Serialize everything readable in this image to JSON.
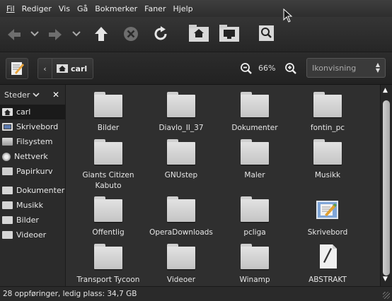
{
  "menubar": {
    "items": [
      {
        "label": "Fil"
      },
      {
        "label": "Rediger"
      },
      {
        "label": "Vis"
      },
      {
        "label": "Gå"
      },
      {
        "label": "Bokmerker"
      },
      {
        "label": "Faner"
      },
      {
        "label": "Hjelp"
      }
    ]
  },
  "toolbar": {
    "buttons": [
      "back-icon",
      "back-history-chevron-icon",
      "forward-icon",
      "forward-history-chevron-icon",
      "up-icon",
      "stop-icon",
      "reload-icon",
      "home-folder-icon",
      "computer-icon",
      "search-icon"
    ]
  },
  "location": {
    "crumb": "carl",
    "zoom": "66%",
    "view_mode": "Ikonvisning"
  },
  "sidebar": {
    "header": "Steder",
    "places": [
      {
        "label": "carl",
        "icon": "home-icon",
        "active": true
      },
      {
        "label": "Skrivebord",
        "icon": "desktop-icon"
      },
      {
        "label": "Filsystem",
        "icon": "drive-icon"
      },
      {
        "label": "Nettverk",
        "icon": "network-icon"
      },
      {
        "label": "Papirkurv",
        "icon": "trash-icon"
      }
    ],
    "bookmarks": [
      {
        "label": "Dokumenter",
        "icon": "folder-icon"
      },
      {
        "label": "Musikk",
        "icon": "folder-icon"
      },
      {
        "label": "Bilder",
        "icon": "folder-icon"
      },
      {
        "label": "Videoer",
        "icon": "folder-icon"
      }
    ]
  },
  "files": [
    {
      "name": "Bilder",
      "icon": "folder-icon"
    },
    {
      "name": "Diavlo_II_37",
      "icon": "folder-icon"
    },
    {
      "name": "Dokumenter",
      "icon": "folder-icon"
    },
    {
      "name": "fontin_pc",
      "icon": "folder-icon"
    },
    {
      "name": "Giants Citizen Kabuto",
      "icon": "folder-icon"
    },
    {
      "name": "GNUstep",
      "icon": "folder-icon"
    },
    {
      "name": "Maler",
      "icon": "folder-icon"
    },
    {
      "name": "Musikk",
      "icon": "folder-icon"
    },
    {
      "name": "Offentlig",
      "icon": "folder-icon"
    },
    {
      "name": "OperaDownloads",
      "icon": "folder-icon"
    },
    {
      "name": "pcliga",
      "icon": "folder-icon"
    },
    {
      "name": "Skrivebord",
      "icon": "desktop-launcher-icon"
    },
    {
      "name": "Transport Tycoon Deluxe",
      "icon": "folder-icon"
    },
    {
      "name": "Videoer",
      "icon": "folder-icon"
    },
    {
      "name": "Winamp",
      "icon": "folder-icon"
    },
    {
      "name": "ABSTRAKT TENKNING.doc",
      "icon": "document-icon"
    }
  ],
  "status": {
    "text": "28 oppføringer, ledig plass: 34,7 GB"
  },
  "colors": {
    "background": "#2f2f2f",
    "folder": "#d6d6d6",
    "text": "#e6e6e6"
  }
}
